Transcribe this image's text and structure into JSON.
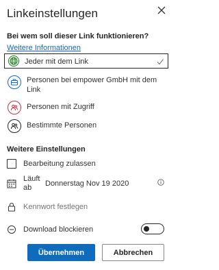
{
  "dialog": {
    "title": "Linkeinstellungen",
    "close_icon": "close-icon"
  },
  "audience": {
    "question": "Bei wem soll dieser Link funktionieren?",
    "more_info": "Weitere Informationen",
    "options": [
      {
        "label": "Jeder mit dem Link",
        "icon": "globe-icon",
        "color": "#107c10",
        "selected": true
      },
      {
        "label": "Personen bei empower GmbH mit dem Link",
        "icon": "briefcase-icon",
        "color": "#0f6cbd",
        "selected": false
      },
      {
        "label": "Personen mit Zugriff",
        "icon": "people-icon",
        "color": "#c4314b",
        "selected": false
      },
      {
        "label": "Bestimmte Personen",
        "icon": "person-icon",
        "color": "#252423",
        "selected": false
      }
    ]
  },
  "settings": {
    "title": "Weitere Einstellungen",
    "allow_edit": {
      "label": "Bearbeitung zulassen",
      "checked": false
    },
    "expiry": {
      "label": "Läuft ab",
      "value": "Donnerstag Nov 19 2020"
    },
    "password": {
      "placeholder": "Kennwort festlegen"
    },
    "block_download": {
      "label": "Download blockieren",
      "enabled": false
    }
  },
  "buttons": {
    "apply": "Übernehmen",
    "cancel": "Abbrechen"
  },
  "colors": {
    "accent": "#0f6cbd",
    "selected_check": "#605e5c"
  }
}
